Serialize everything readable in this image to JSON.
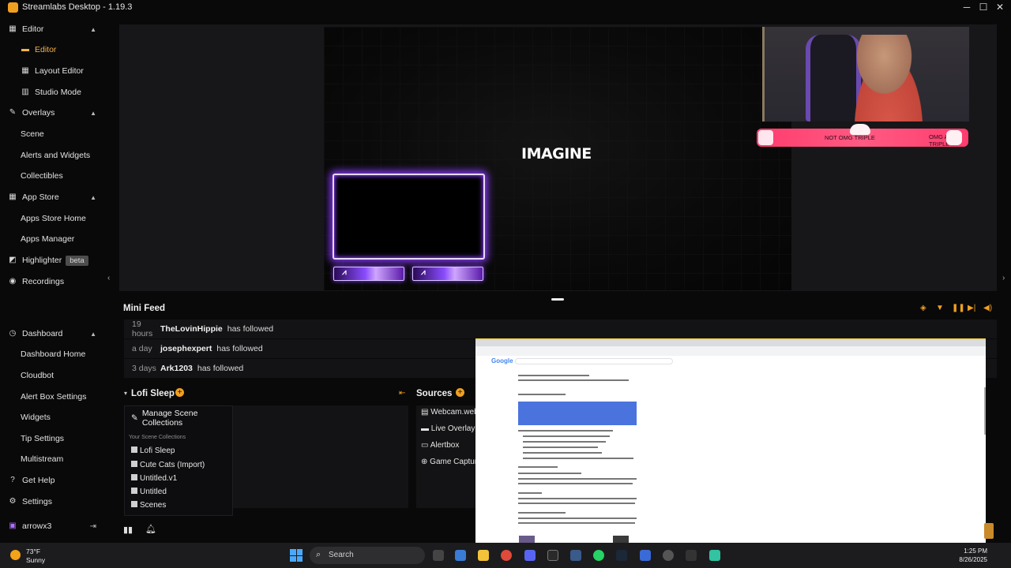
{
  "app": {
    "title": "Streamlabs Desktop - 1.19.3"
  },
  "sidebar": {
    "editor": {
      "label": "Editor",
      "items": [
        "Editor",
        "Layout Editor",
        "Studio Mode"
      ]
    },
    "overlays": {
      "label": "Overlays",
      "items": [
        "Scene",
        "Alerts and Widgets",
        "Collectibles"
      ]
    },
    "appstore": {
      "label": "App Store",
      "items": [
        "Apps Store Home",
        "Apps Manager"
      ]
    },
    "highlighter": {
      "label": "Highlighter",
      "badge": "beta"
    },
    "recordings": "Recordings",
    "dashboard": {
      "label": "Dashboard",
      "items": [
        "Dashboard Home",
        "Cloudbot",
        "Alert Box Settings",
        "Widgets",
        "Tip Settings",
        "Multistream"
      ]
    },
    "get_help": "Get Help",
    "settings": "Settings",
    "user": "arrowx3"
  },
  "preview": {
    "logo_text": "IMAGINE",
    "alert_text_1": "NOT OMG TRIPLE",
    "alert_text_2": "OMG A TRIPLE"
  },
  "mini_feed": {
    "title": "Mini Feed",
    "rows": [
      {
        "when": "19 hours",
        "who": "TheLovinHippie",
        "what": "has followed"
      },
      {
        "when": "a day",
        "who": "josephexpert",
        "what": "has followed"
      },
      {
        "when": "3 days",
        "who": "Ark1203",
        "what": "has followed"
      }
    ]
  },
  "scenes": {
    "title": "Lofi Sleep",
    "manage_label": "Manage Scene Collections",
    "collections_header": "Your Scene Collections",
    "collections": [
      "Lofi Sleep",
      "Cute Cats (Import)",
      "Untitled.v1",
      "Untitled",
      "Scenes"
    ]
  },
  "sources": {
    "title": "Sources",
    "items": [
      "Webcam.web",
      "Live Overlay",
      "Alertbox",
      "Game Captur"
    ]
  },
  "browser": {
    "google": "Google"
  },
  "taskbar": {
    "temp": "73°F",
    "condition": "Sunny",
    "search_label": "Search",
    "time": "1:25 PM",
    "date": "8/26/2025"
  },
  "colors": {
    "accent": "#f0a020",
    "alert": "#ff4a78",
    "frame_glow": "#8a3cff"
  }
}
